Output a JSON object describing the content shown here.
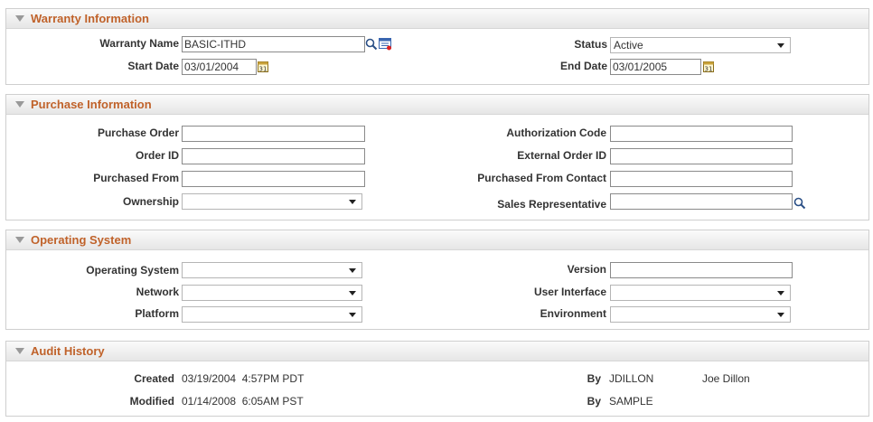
{
  "warranty": {
    "title": "Warranty Information",
    "name_label": "Warranty Name",
    "name_value": "BASIC-ITHD",
    "status_label": "Status",
    "status_value": "Active",
    "start_label": "Start Date",
    "start_value": "03/01/2004",
    "end_label": "End Date",
    "end_value": "03/01/2005"
  },
  "purchase": {
    "title": "Purchase Information",
    "po_label": "Purchase Order",
    "auth_label": "Authorization Code",
    "order_id_label": "Order ID",
    "ext_order_label": "External Order ID",
    "from_label": "Purchased From",
    "from_contact_label": "Purchased From Contact",
    "ownership_label": "Ownership",
    "sales_rep_label": "Sales Representative"
  },
  "os": {
    "title": "Operating System",
    "os_label": "Operating System",
    "version_label": "Version",
    "network_label": "Network",
    "ui_label": "User Interface",
    "platform_label": "Platform",
    "env_label": "Environment"
  },
  "audit": {
    "title": "Audit History",
    "created_label": "Created",
    "created_value": "03/19/2004  4:57PM PDT",
    "created_by_label": "By",
    "created_by_id": "JDILLON",
    "created_by_name": "Joe Dillon",
    "modified_label": "Modified",
    "modified_value": "01/14/2008  6:05AM PST",
    "modified_by_label": "By",
    "modified_by_id": "SAMPLE"
  },
  "colors": {
    "section_title": "#c0622a",
    "border": "#cfcfcf"
  }
}
